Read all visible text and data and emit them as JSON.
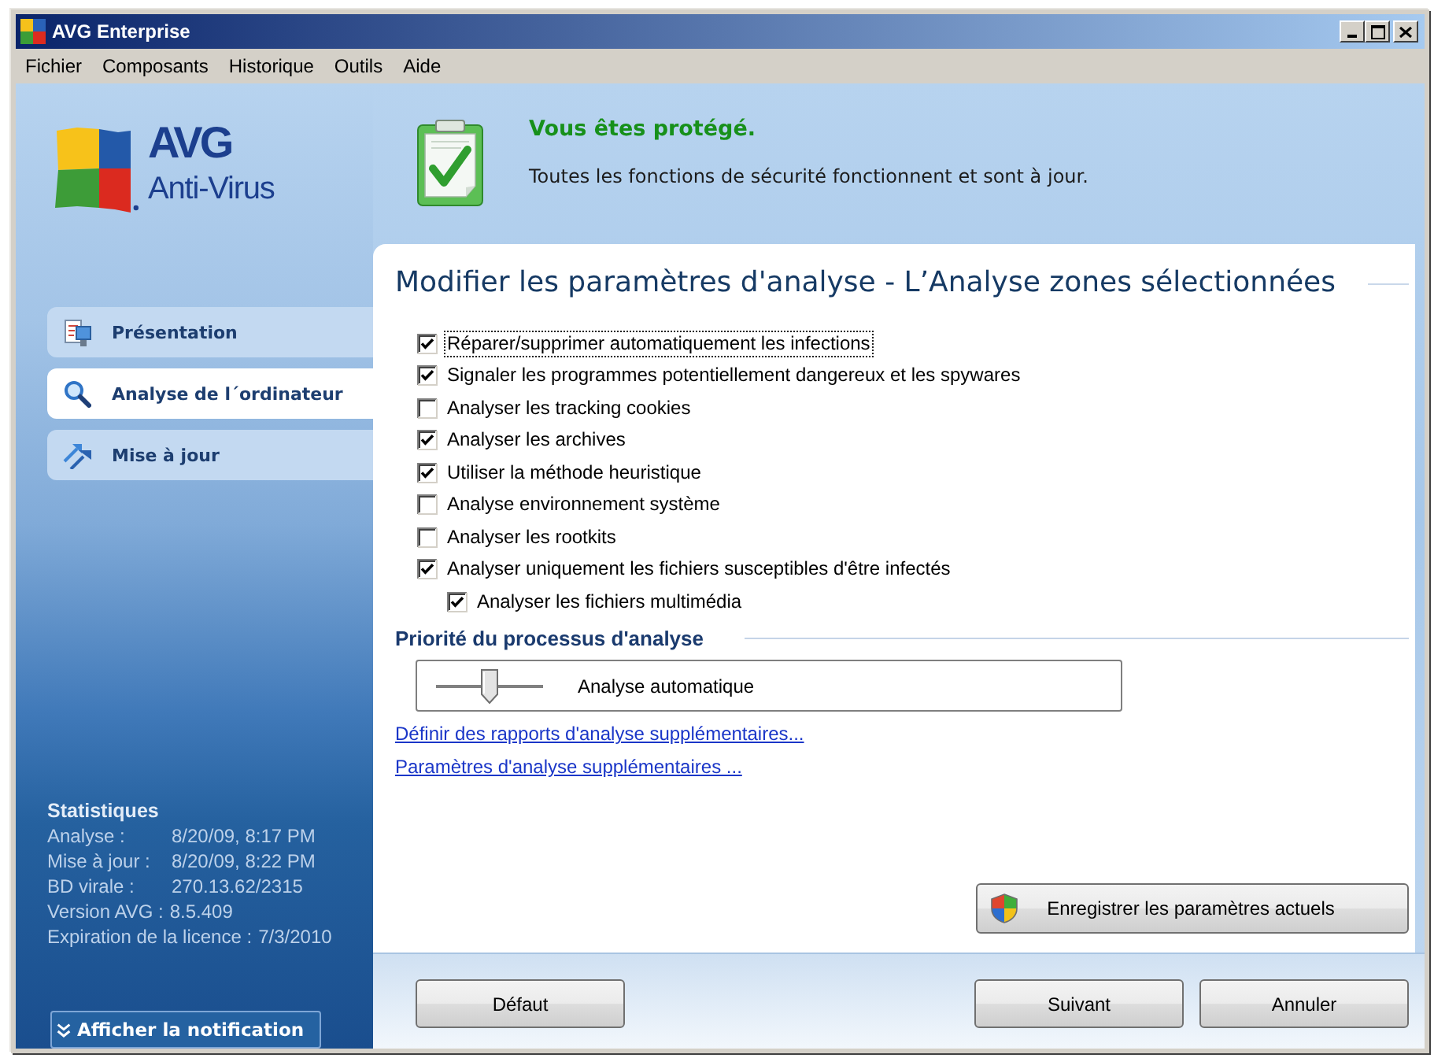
{
  "window": {
    "title": "AVG Enterprise"
  },
  "menu": [
    "Fichier",
    "Composants",
    "Historique",
    "Outils",
    "Aide"
  ],
  "logo": {
    "name": "AVG",
    "product": "Anti-Virus"
  },
  "status": {
    "title": "Vous êtes protégé.",
    "message": "Toutes les fonctions de sécurité fonctionnent et sont à jour."
  },
  "sidebar": {
    "items": [
      {
        "label": "Présentation",
        "selected": false
      },
      {
        "label": "Analyse de l´ordinateur",
        "selected": true
      },
      {
        "label": "Mise à jour",
        "selected": false
      }
    ]
  },
  "statistics": {
    "title": "Statistiques",
    "rows": [
      {
        "kind": "aligned",
        "label": "Analyse :",
        "value": "8/20/09, 8:17 PM"
      },
      {
        "kind": "aligned",
        "label": "Mise à jour :",
        "value": "8/20/09, 8:22 PM"
      },
      {
        "kind": "aligned",
        "label": "BD virale :",
        "value": "270.13.62/2315"
      },
      {
        "kind": "inline",
        "label": "Version AVG :",
        "value": "8.5.409"
      },
      {
        "kind": "inline",
        "label": "Expiration de la licence :",
        "value": "7/3/2010"
      }
    ]
  },
  "notification_button": {
    "label": "Afficher la notification"
  },
  "panel": {
    "heading": "Modifier les paramètres d'analyse - L’Analyse zones sélectionnées",
    "options": [
      {
        "label": "Réparer/supprimer automatiquement les infections",
        "checked": true,
        "focused": true
      },
      {
        "label": "Signaler les programmes potentiellement dangereux et les spywares",
        "checked": true,
        "focused": false
      },
      {
        "label": "Analyser les tracking cookies",
        "checked": false,
        "focused": false
      },
      {
        "label": "Analyser les archives",
        "checked": true,
        "focused": false
      },
      {
        "label": "Utiliser la méthode heuristique",
        "checked": true,
        "focused": false
      },
      {
        "label": "Analyse environnement système",
        "checked": false,
        "focused": false
      },
      {
        "label": "Analyser les rootkits",
        "checked": false,
        "focused": false
      },
      {
        "label": "Analyser uniquement les fichiers susceptibles d'être infectés",
        "checked": true,
        "focused": false,
        "children": [
          {
            "label": "Analyser les fichiers multimédia",
            "checked": true,
            "focused": false
          }
        ]
      }
    ],
    "priority": {
      "title": "Priorité du processus d'analyse",
      "slider": {
        "level": 0.5,
        "reading": "Analyse automatique"
      }
    },
    "links": [
      "Définir des rapports d'analyse supplémentaires...",
      "Paramètres d'analyse supplémentaires ..."
    ],
    "save_button": "Enregistrer les paramètres actuels"
  },
  "footer": {
    "left_buttons": [
      "Défaut"
    ],
    "right_buttons": [
      "Suivant",
      "Annuler"
    ]
  }
}
